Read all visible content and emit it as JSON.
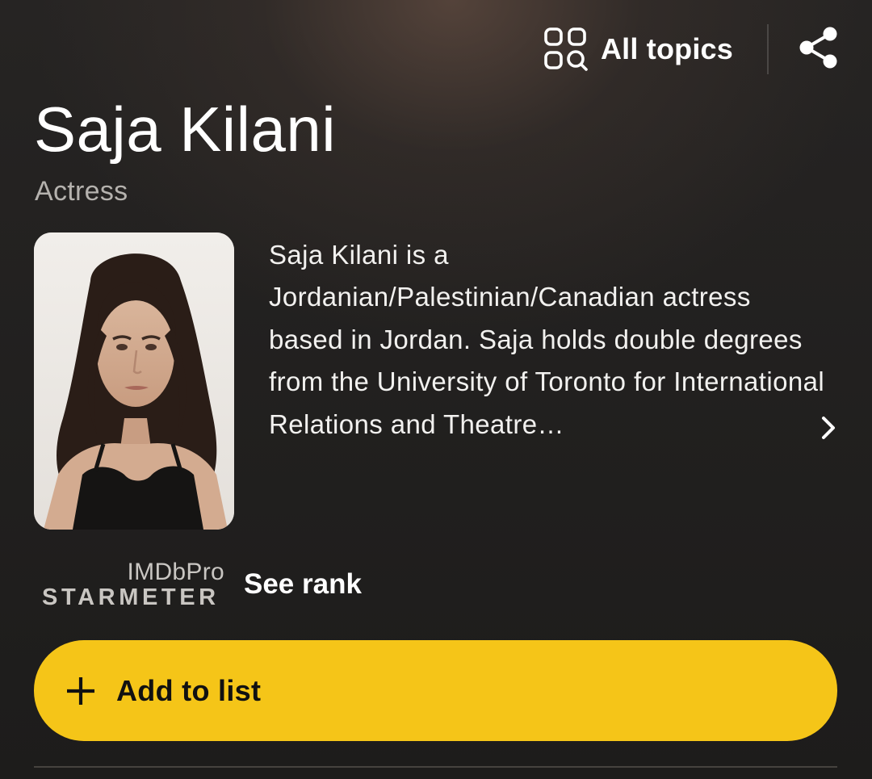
{
  "header": {
    "all_topics_label": "All topics",
    "topics_icon": "topics-grid-search-icon",
    "share_icon": "share-icon"
  },
  "person": {
    "name": "Saja Kilani",
    "role": "Actress",
    "bio": "Saja Kilani is a Jordanian/Palestinian/Canadian actress based in Jordan. Saja holds double degrees from the University of Toronto for International Relations and Theatre…"
  },
  "starmeter": {
    "imdbpro_label": "IMDbPro",
    "starmeter_label": "STARMETER",
    "see_rank_label": "See rank"
  },
  "actions": {
    "add_to_list_label": "Add to list"
  },
  "colors": {
    "accent": "#f5c518",
    "background": "#1f1e1d",
    "muted_text": "#b5b2ae"
  }
}
